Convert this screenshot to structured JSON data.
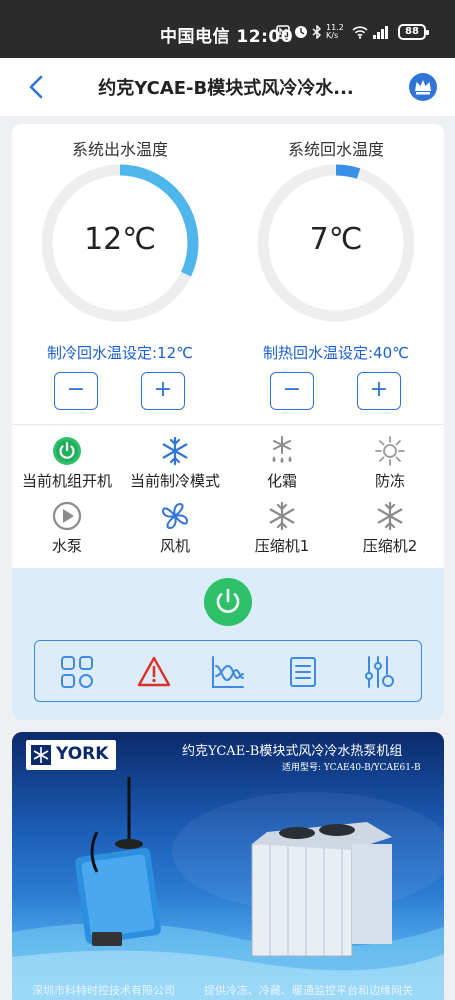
{
  "status_bar": {
    "carrier_time": "中国电信 12:00",
    "net_speed": "11.2 K/s",
    "battery": "88"
  },
  "header": {
    "title": "约克YCAE-B模块式风冷冷水...",
    "back_icon": "chevron-left-icon",
    "vip_icon": "crown-icon"
  },
  "gauges": [
    {
      "title": "系统出水温度",
      "value": "12℃",
      "fill": 0.32,
      "color": "#4fb6ec"
    },
    {
      "title": "系统回水温度",
      "value": "7℃",
      "fill": 0.05,
      "color": "#3a8fe6"
    }
  ],
  "setpoints": {
    "cooling": "制冷回水温设定:12℃",
    "heating": "制热回水温设定:40℃",
    "minus": "−",
    "plus": "+"
  },
  "status_items": [
    {
      "label": "当前机组开机",
      "icon": "power-on-icon"
    },
    {
      "label": "当前制冷模式",
      "icon": "snowflake-icon"
    },
    {
      "label": "化霜",
      "icon": "defrost-icon"
    },
    {
      "label": "防冻",
      "icon": "sun-icon"
    },
    {
      "label": "水泵",
      "icon": "pump-play-icon"
    },
    {
      "label": "风机",
      "icon": "fan-icon"
    },
    {
      "label": "压缩机1",
      "icon": "snowflake-gray-icon"
    },
    {
      "label": "压缩机2",
      "icon": "snowflake-gray-icon"
    }
  ],
  "controls": {
    "power_icon": "power-icon",
    "functions": [
      "grid-icon",
      "alarm-icon",
      "curve-chart-icon",
      "list-icon",
      "settings-sliders-icon"
    ]
  },
  "banner": {
    "brand": "YORK",
    "title": "约克YCAE-B模块式风冷冷水热泵机组",
    "model": "适用型号: YCAE40-B/YCAE61-B",
    "footer_left": "深圳市科特时控技术有限公司",
    "footer_right": "提供冷冻、冷藏、暖通监控平台和边缘网关"
  },
  "colors": {
    "accent_blue": "#2f74d6",
    "setpoint_text": "#1a5fd0",
    "power_green": "#2fc06a",
    "panel_bg": "#dcedf9",
    "alarm_red": "#e0302a"
  }
}
